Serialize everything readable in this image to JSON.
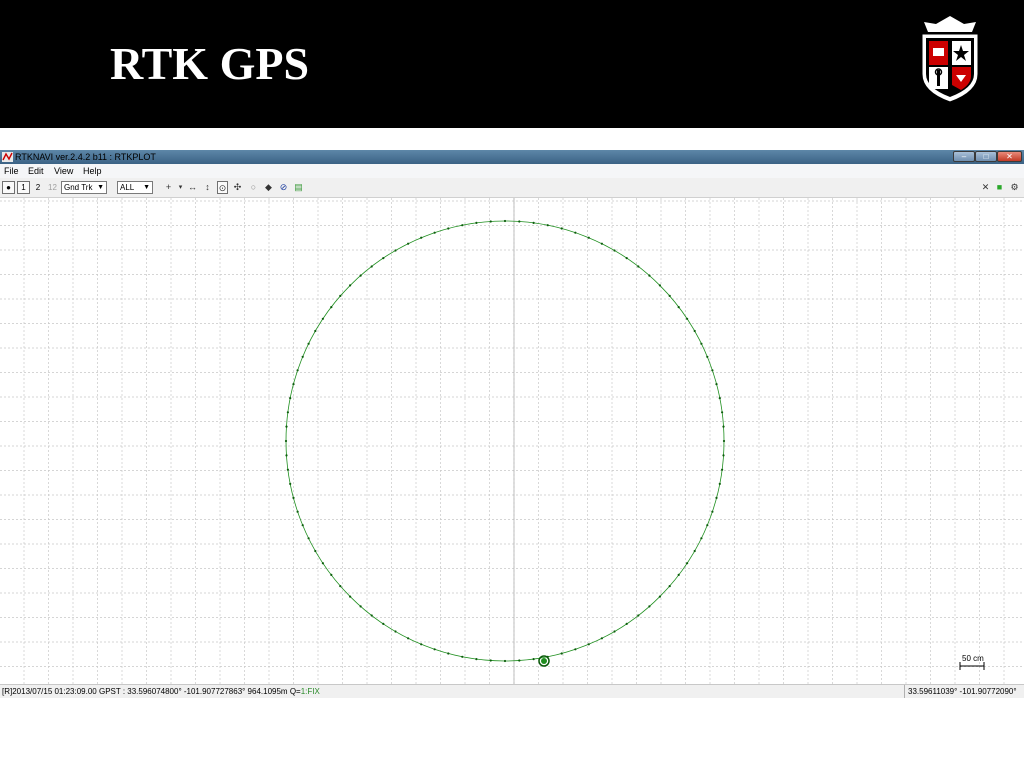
{
  "slide": {
    "title": "RTK GPS"
  },
  "window": {
    "title": "RTKNAVI ver.2.4.2 b11 : RTKPLOT",
    "controls": {
      "minimize": "–",
      "maximize": "□",
      "close": "✕"
    }
  },
  "menu": {
    "items": [
      "File",
      "Edit",
      "View",
      "Help"
    ]
  },
  "toolbar": {
    "btn_dot": "●",
    "btn_1": "1",
    "btn_2": "2",
    "btn_12": "12",
    "plot_type": "Gnd Trk",
    "sat_select": "ALL",
    "icons": [
      "crosshair-icon",
      "fit-horizontal-icon",
      "fit-vertical-icon",
      "center-icon",
      "pan-icon",
      "circle-icon",
      "point-icon",
      "satellite-icon",
      "map-icon"
    ],
    "close": "✕",
    "status_light": "■",
    "gear": "⚙"
  },
  "plot": {
    "scale_label": "50 cm",
    "track_color": "#1f8f1f",
    "grid_color": "#c8c8c8"
  },
  "status": {
    "left_main": "[R]2013/07/15 01:23:09.00 GPST :  33.596074800° -101.907727863°  964.1095m  Q=",
    "left_fix": "1:FIX",
    "right": "33.59611039° -101.90772090°"
  }
}
